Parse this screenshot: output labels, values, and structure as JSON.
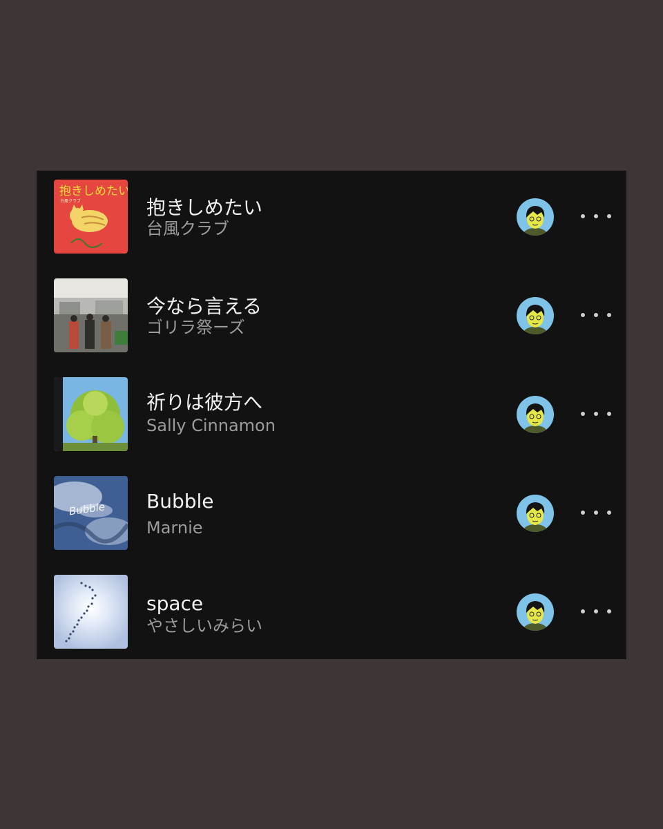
{
  "tracks": [
    {
      "title": "抱きしめたい",
      "artist": "台風クラブ",
      "cover": "orange-cat-cover",
      "cover_text": "抱きしめたい",
      "cover_small_text": "台風クラブ"
    },
    {
      "title": "今なら言える",
      "artist": "ゴリラ祭ーズ",
      "cover": "band-photo-cover"
    },
    {
      "title": "祈りは彼方へ",
      "artist": "Sally Cinnamon",
      "cover": "tree-sky-cover"
    },
    {
      "title": "Bubble",
      "artist": "Marnie",
      "cover": "earth-blue-cover",
      "cover_text": "Bubble"
    },
    {
      "title": "space",
      "artist": "やさしいみらい",
      "cover": "footprints-sky-cover"
    }
  ],
  "icons": {
    "avatar": "user-avatar-icon",
    "more": "more-options-icon"
  },
  "colors": {
    "background": "#3e3537",
    "panel": "#121212",
    "title": "#f2f2f2",
    "artist": "#9c9c9c",
    "avatar_bg": "#7fc3e8"
  }
}
